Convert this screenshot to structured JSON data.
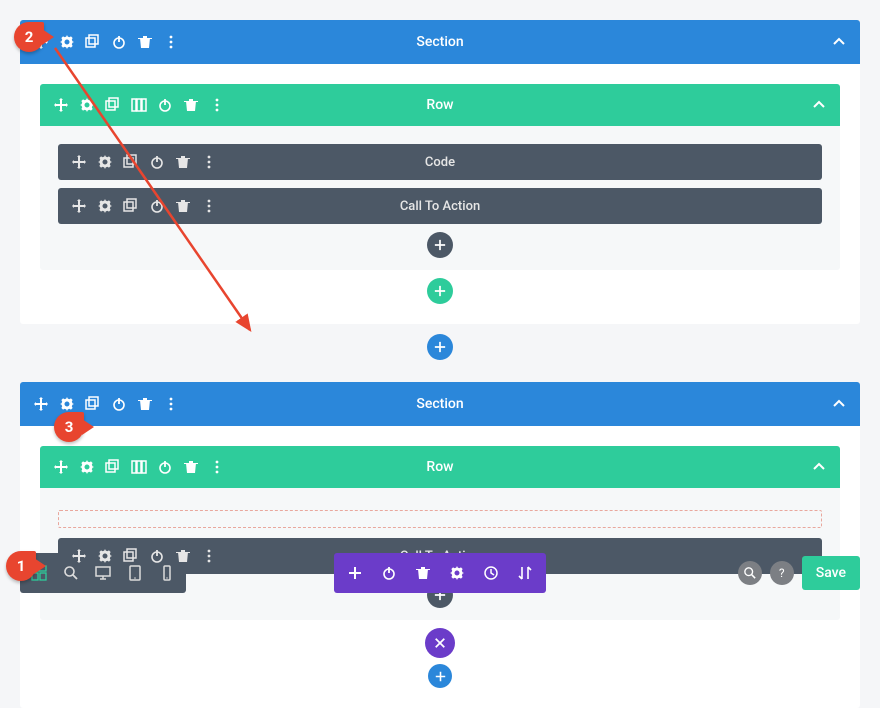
{
  "sections": [
    {
      "title": "Section",
      "row": {
        "title": "Row",
        "modules": [
          {
            "title": "Code"
          },
          {
            "title": "Call To Action"
          }
        ]
      }
    },
    {
      "title": "Section",
      "row": {
        "title": "Row",
        "modules": [
          {
            "title": "Call To Action"
          }
        ]
      }
    }
  ],
  "bottom_bar": {
    "save_label": "Save"
  },
  "markers": {
    "m1": "1",
    "m2": "2",
    "m3": "3"
  },
  "icons": {
    "move": "move-icon",
    "gear": "gear-icon",
    "duplicate": "duplicate-icon",
    "columns": "columns-icon",
    "power": "power-icon",
    "trash": "trash-icon",
    "more": "more-icon",
    "caret": "chevron-up-icon",
    "plus": "plus-icon",
    "close": "close-icon",
    "wireframe": "wireframe-icon",
    "zoom": "zoom-icon",
    "desktop": "desktop-icon",
    "tablet": "tablet-icon",
    "phone": "phone-icon",
    "history": "history-icon",
    "sort": "sort-icon",
    "help": "help-icon"
  }
}
